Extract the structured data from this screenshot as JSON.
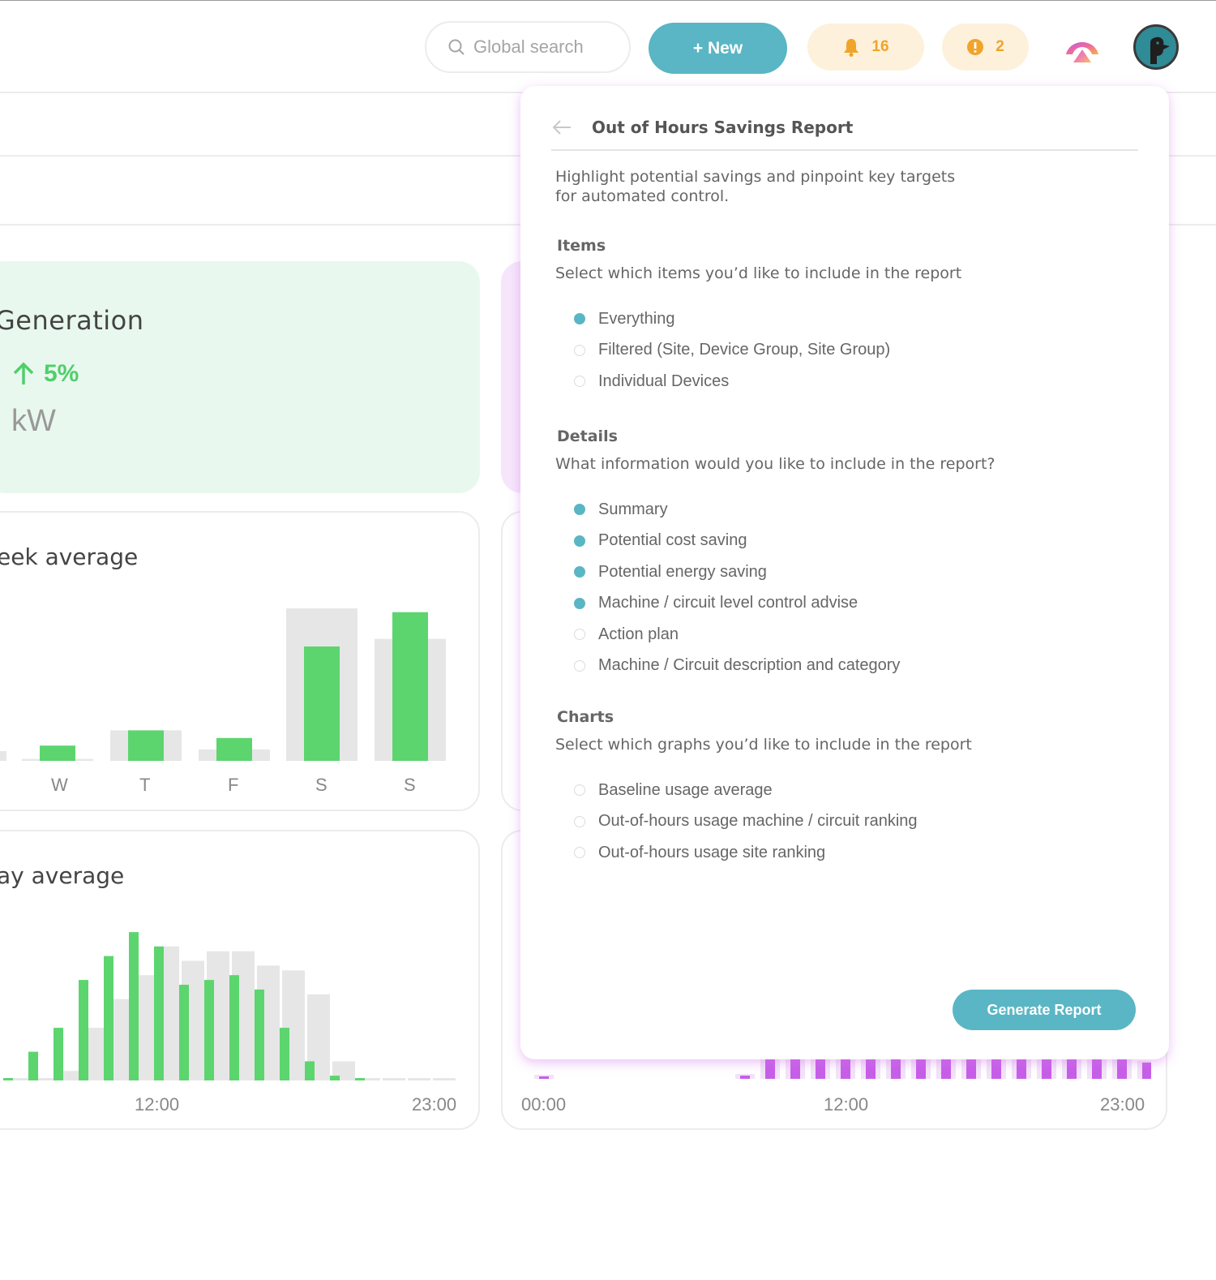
{
  "header": {
    "search_placeholder": "Global search",
    "new_button": "+ New",
    "notifications_count": "16",
    "alerts_count": "2"
  },
  "background": {
    "generation_title": "Generation",
    "generation_change": "5%",
    "generation_unit": "kW",
    "week_title": "eek average",
    "week_labels": [
      "W",
      "T",
      "F",
      "S",
      "S"
    ],
    "day_title": "ay average",
    "day_x_labels": [
      "12:00",
      "23:00"
    ],
    "right_x_labels": [
      "00:00",
      "12:00",
      "23:00"
    ]
  },
  "chart_data": [
    {
      "type": "bar",
      "categories": [
        "W",
        "T",
        "F",
        "S",
        "S"
      ],
      "series": [
        {
          "values": [
            4,
            8,
            6,
            30,
            39
          ]
        },
        {
          "values": [
            0.5,
            8,
            3,
            40,
            32
          ]
        }
      ]
    },
    {
      "type": "bar",
      "x_labels": [
        "12:00",
        "23:00"
      ],
      "series": [
        {
          "values": [
            0.5,
            6,
            11,
            21,
            26,
            31,
            28,
            20,
            21,
            22,
            19,
            11,
            4,
            1,
            0.5,
            0,
            0,
            0
          ]
        },
        {
          "values": [
            0.5,
            0.5,
            2,
            11,
            17,
            22,
            28,
            25,
            27,
            27,
            24,
            23,
            18,
            4,
            0.5,
            0.5,
            0.5,
            0.5
          ]
        }
      ]
    }
  ],
  "panel": {
    "title": "Out of Hours Savings Report",
    "description": "Highlight potential savings and pinpoint key targets for automated control.",
    "items": {
      "title": "Items",
      "subtitle": "Select which items you’d like to include in the report",
      "options": [
        {
          "label": "Everything",
          "selected": true
        },
        {
          "label": "Filtered (Site, Device Group, Site Group)",
          "selected": false
        },
        {
          "label": "Individual Devices",
          "selected": false
        }
      ]
    },
    "details": {
      "title": "Details",
      "subtitle": "What information would you like to include in the report?",
      "options": [
        {
          "label": "Summary",
          "selected": true
        },
        {
          "label": "Potential cost saving",
          "selected": true
        },
        {
          "label": "Potential energy saving",
          "selected": true
        },
        {
          "label": "Machine / circuit level control advise",
          "selected": true
        },
        {
          "label": "Action plan",
          "selected": false
        },
        {
          "label": "Machine / Circuit description and category",
          "selected": false
        }
      ]
    },
    "charts": {
      "title": "Charts",
      "subtitle": "Select which graphs you’d like to include in the report",
      "options": [
        {
          "label": "Baseline usage average",
          "selected": false
        },
        {
          "label": "Out-of-hours usage machine / circuit ranking",
          "selected": false
        },
        {
          "label": "Out-of-hours usage site ranking",
          "selected": false
        }
      ]
    },
    "generate_button": "Generate Report"
  },
  "colors": {
    "accent": "#5ab6c4",
    "green": "#5cd56f",
    "purple": "#c65ee8",
    "warning": "#f0a42a"
  }
}
